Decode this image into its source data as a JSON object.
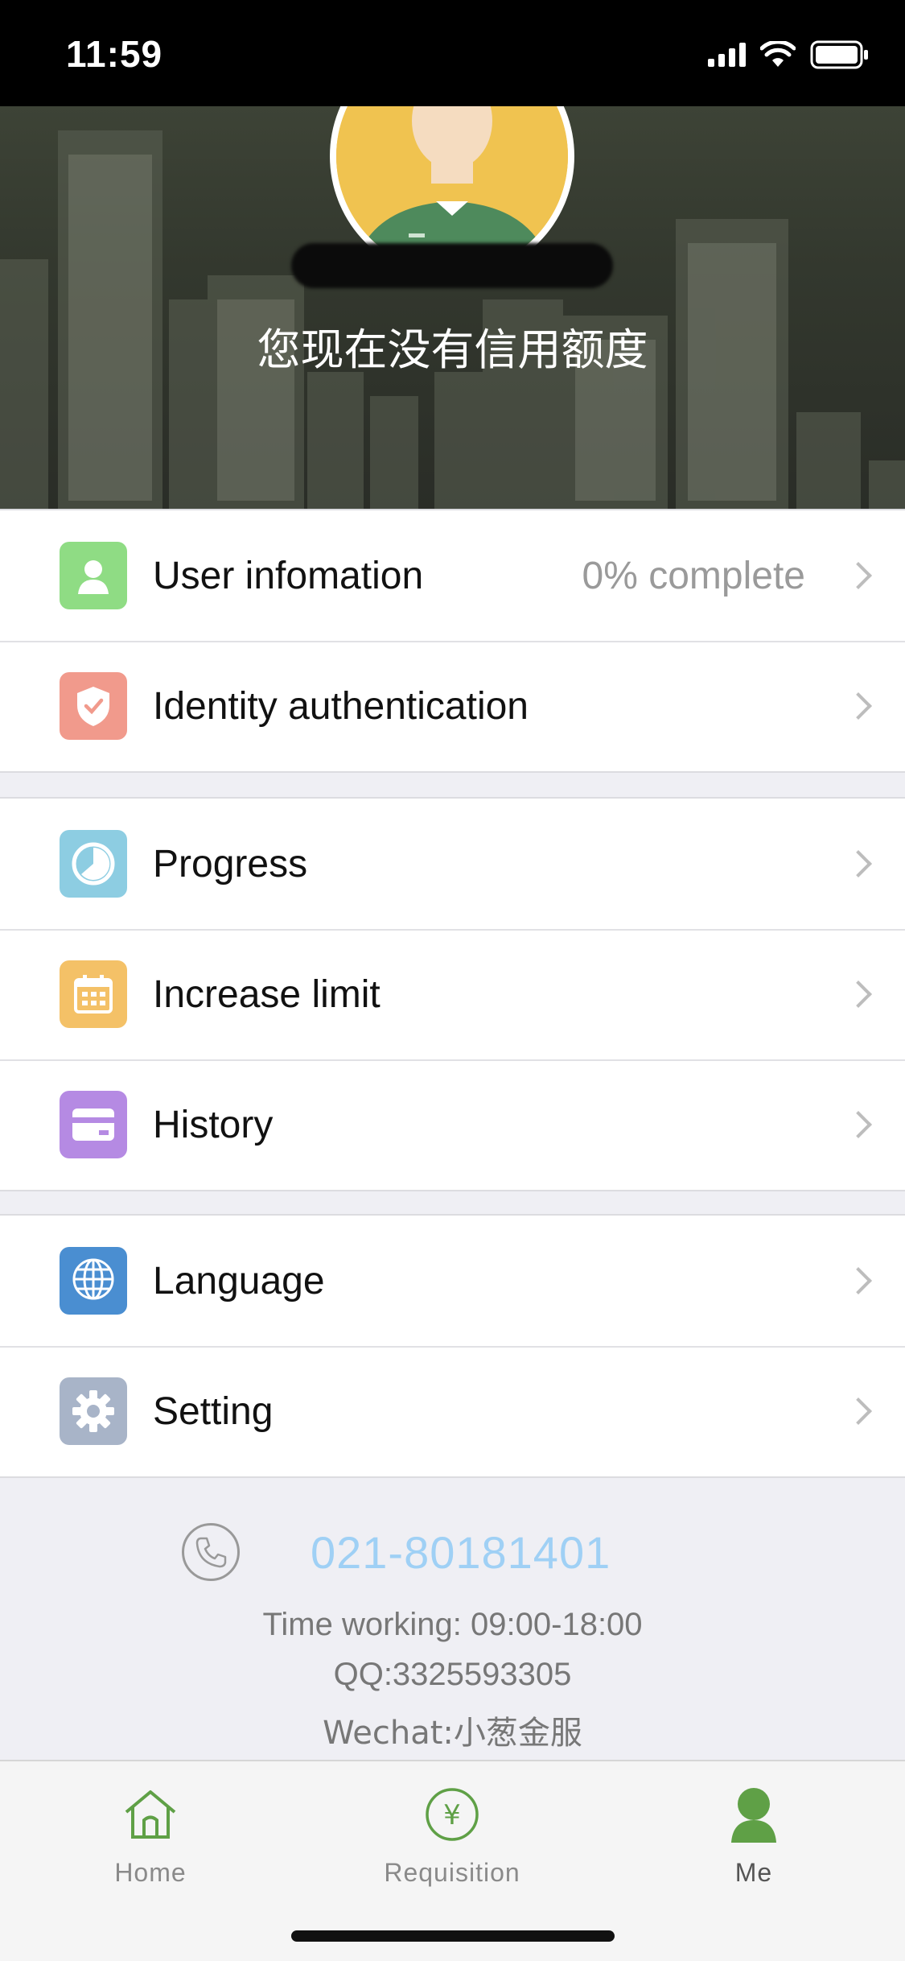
{
  "status_bar": {
    "time": "11:59"
  },
  "header": {
    "credit_text": "您现在没有信用额度"
  },
  "menu": {
    "group1": [
      {
        "label": "User infomation",
        "value": "0% complete",
        "icon": "user-icon",
        "color": "#8fdc84"
      },
      {
        "label": "Identity authentication",
        "icon": "shield-icon",
        "color": "#f19a8c"
      }
    ],
    "group2": [
      {
        "label": "Progress",
        "icon": "clock-icon",
        "color": "#8dcde2"
      },
      {
        "label": "Increase limit",
        "icon": "calendar-icon",
        "color": "#f4c167"
      },
      {
        "label": "History",
        "icon": "card-icon",
        "color": "#b58ae3"
      }
    ],
    "group3": [
      {
        "label": "Language",
        "icon": "globe-icon",
        "color": "#4a8ed1"
      },
      {
        "label": "Setting",
        "icon": "gear-icon",
        "color": "#a8b4c8"
      }
    ]
  },
  "contact": {
    "phone": "021-80181401",
    "hours": "Time working: 09:00-18:00",
    "qq": "QQ:3325593305",
    "wechat": "Wechat:小葱金服"
  },
  "tabs": [
    {
      "label": "Home",
      "icon": "home-icon"
    },
    {
      "label": "Requisition",
      "icon": "yen-icon"
    },
    {
      "label": "Me",
      "icon": "person-icon",
      "active": true
    }
  ],
  "colors": {
    "tab_green": "#5fa046",
    "phone_blue": "#9fd0f5"
  }
}
